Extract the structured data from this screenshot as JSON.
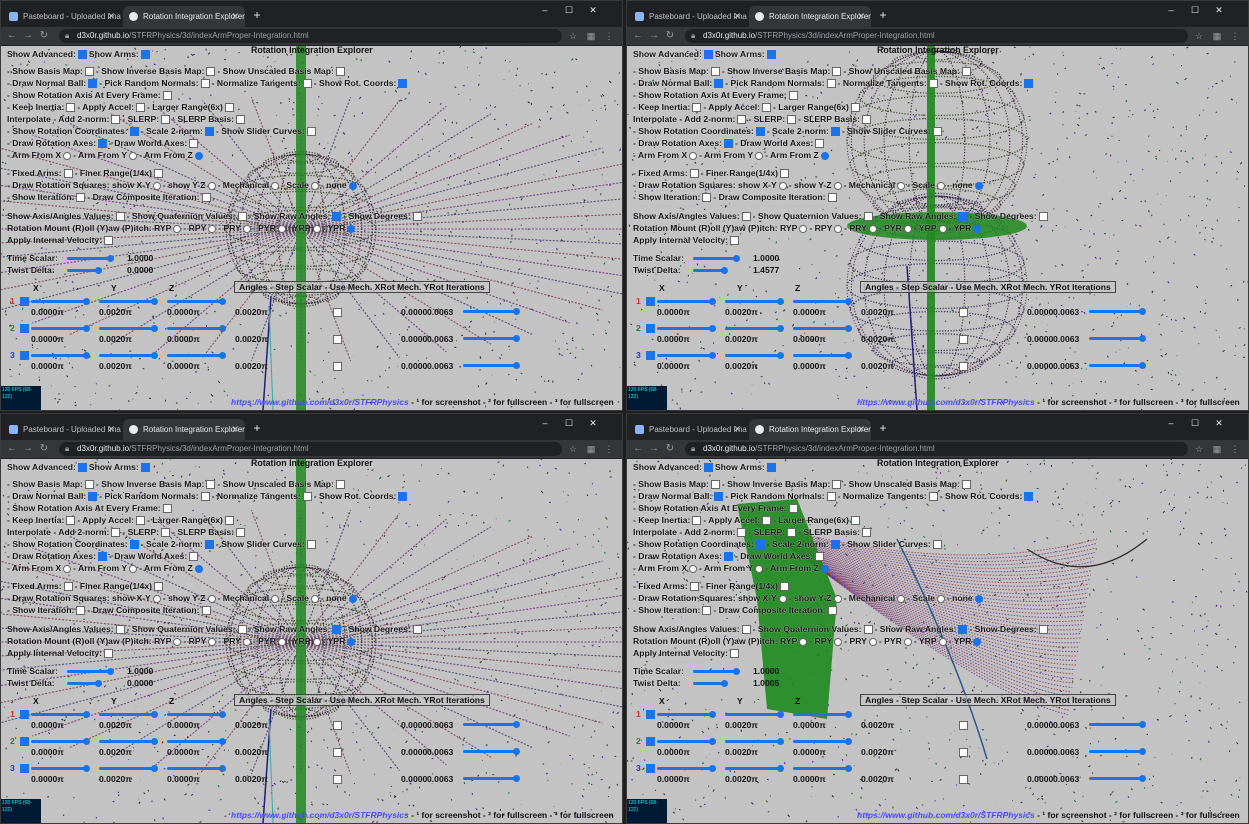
{
  "windows": [
    {
      "tabs": [
        {
          "label": "Pasteboard - Uploaded Image"
        },
        {
          "label": "Rotation Integration Explorer"
        }
      ],
      "url": {
        "host": "d3x0r.github.io",
        "path": "/STFRPhysics/3d/indexArmProper-Integration.html"
      },
      "variant": "ball",
      "time_scalar": "1.0000",
      "twist_delta": "0.0000"
    },
    {
      "tabs": [
        {
          "label": "Pasteboard - Uploaded Image"
        },
        {
          "label": "Rotation Integration Explorer"
        }
      ],
      "url": {
        "host": "d3x0r.github.io",
        "path": "/STFRPhysics/3d/indexArmProper-Integration.html"
      },
      "variant": "double",
      "time_scalar": "1.0000",
      "twist_delta": "1.4577"
    },
    {
      "tabs": [
        {
          "label": "Pasteboard - Uploaded Image"
        },
        {
          "label": "Rotation Integration Explorer"
        }
      ],
      "url": {
        "host": "d3x0r.github.io",
        "path": "/STFRPhysics/3d/indexArmProper-Integration.html"
      },
      "variant": "ball",
      "time_scalar": "1.0000",
      "twist_delta": "0.0000"
    },
    {
      "tabs": [
        {
          "label": "Pasteboard - Uploaded Image"
        },
        {
          "label": "Rotation Integration Explorer"
        }
      ],
      "url": {
        "host": "d3x0r.github.io",
        "path": "/STFRPhysics/3d/indexArmProper-Integration.html"
      },
      "variant": "surface",
      "time_scalar": "1.0000",
      "twist_delta": "1.0005"
    }
  ],
  "panel": {
    "title": "Rotation Integration Explorer",
    "show_advanced": "Show Advanced:",
    "show_arms": "Show Arms:",
    "show_basis_map": "- Show Basis Map:",
    "show_inverse_basis_map": "- Show Inverse Basis Map:",
    "show_unscaled_basis_map": "- Show Unscaled Basis Map:",
    "draw_normal_ball": "- Draw Normal Ball:",
    "pick_random_normals": "- Pick Random Normals:",
    "normalize_tangents": "- Normalize Tangents:",
    "show_rot_coords": "- Show Rot. Coords:",
    "show_rotation_axis": "- Show Rotation Axis At Every Frame:",
    "keep_inertia": "- Keep Inertia:",
    "apply_accel": "- Apply Accel:",
    "larger_range": "- Larger Range(6x)",
    "interpolate": "Interpolate - Add 2-norm:",
    "slerp": "- SLERP:",
    "slerp_basis": "- SLERP Basis:",
    "show_rotation_coordinates": "- Show Rotation Coordinates:",
    "scale_2_norm": "- Scale 2-norm:",
    "show_slider_curves": "- Show Slider Curves:",
    "draw_rotation_axes": "- Draw Rotation Axes:",
    "draw_world_axes": "- Draw World Axes:",
    "arm_from_x": "- Arm From X",
    "arm_from_y": "- Arm From Y",
    "arm_from_z": "- Arm From Z",
    "fixed_arms": "- Fixed Arms:",
    "finer_range": "- Finer Range(1/4x)",
    "draw_rotation_squares": "- Draw Rotation Squares: show X-Y",
    "show_y_z": "- show Y-Z",
    "mechanical": "- Mechanical",
    "scale": "- Scale",
    "none": "- none",
    "show_iteration": "- Show Iteration:",
    "draw_composite_iteration": "- Draw Composite Iteration:",
    "show_axis_angles_values": "Show Axis/Angles Values:",
    "show_quaternion_values": "- Show Quaternion Values:",
    "show_raw_angles": "- Show Raw Angles:",
    "show_degrees": "- Show Degrees:",
    "rotation_mount": "Rotation Mount (R)oll (Y)aw (P)itch: RYP",
    "rpy": "- RPY",
    "pry": "- PRY",
    "pyr": "- PYR",
    "yrp": "- YRP",
    "ypr": "- YPR",
    "apply_internal_velocity": "Apply Internal Velocity:",
    "time_scalar_label": "Time Scalar:",
    "twist_delta_label": "Twist Delta:",
    "table_header": "Angles - Step Scalar - Use Mech. XRot Mech. YRot Iterations",
    "axis_x": "X",
    "axis_y": "Y",
    "axis_z": "Z",
    "row_labels": [
      "1",
      "2",
      "3"
    ],
    "angle_value": "0.0000π",
    "step_value": "0.0020π",
    "mech_value": "0.0000",
    "iter_value": "0.0063",
    "fps": "120 FPS (68-122)",
    "footer_link": "https://www.github.com/d3x0r/STFRPhysics",
    "footer_text": "- ¹ for screenshot - ² for fullscreen - ³ for fullscreen"
  },
  "colors": {
    "accent": "#1a73e8",
    "sphere_green": "#1e8a1e",
    "tab_bg": "#202124",
    "content_bg": "#c3c3c3"
  }
}
